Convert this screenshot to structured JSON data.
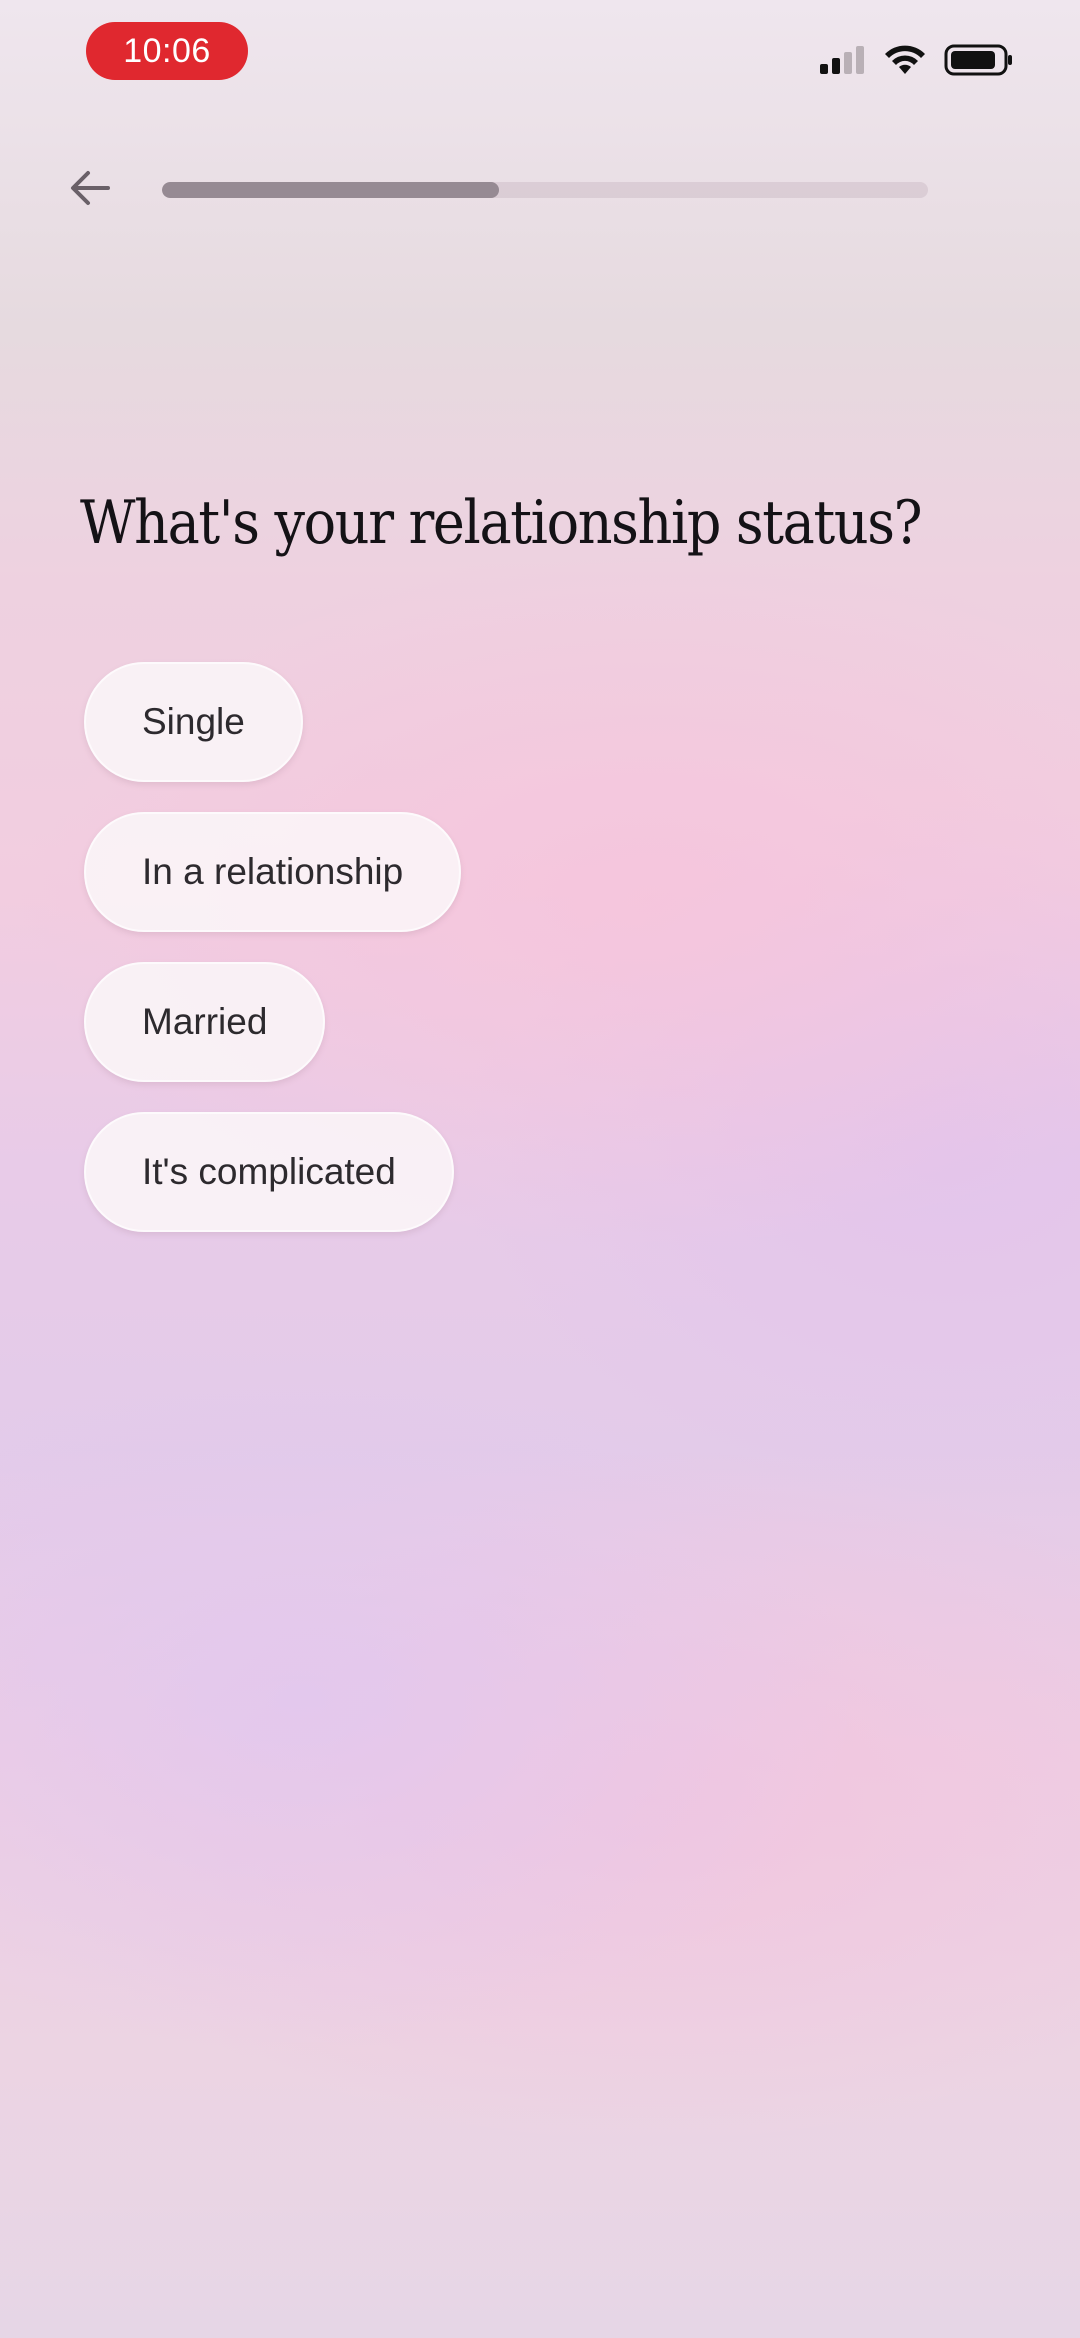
{
  "status_bar": {
    "time": "10:06",
    "icons": [
      "cellular-signal-icon",
      "wifi-icon",
      "battery-icon"
    ],
    "time_pill_color": "#e0282f"
  },
  "header": {
    "back_icon": "arrow-left-icon",
    "progress_fraction": 0.44
  },
  "question": "What's your relationship status?",
  "options": [
    {
      "label": "Single"
    },
    {
      "label": "In a relationship"
    },
    {
      "label": "Married"
    },
    {
      "label": "It's complicated"
    }
  ]
}
